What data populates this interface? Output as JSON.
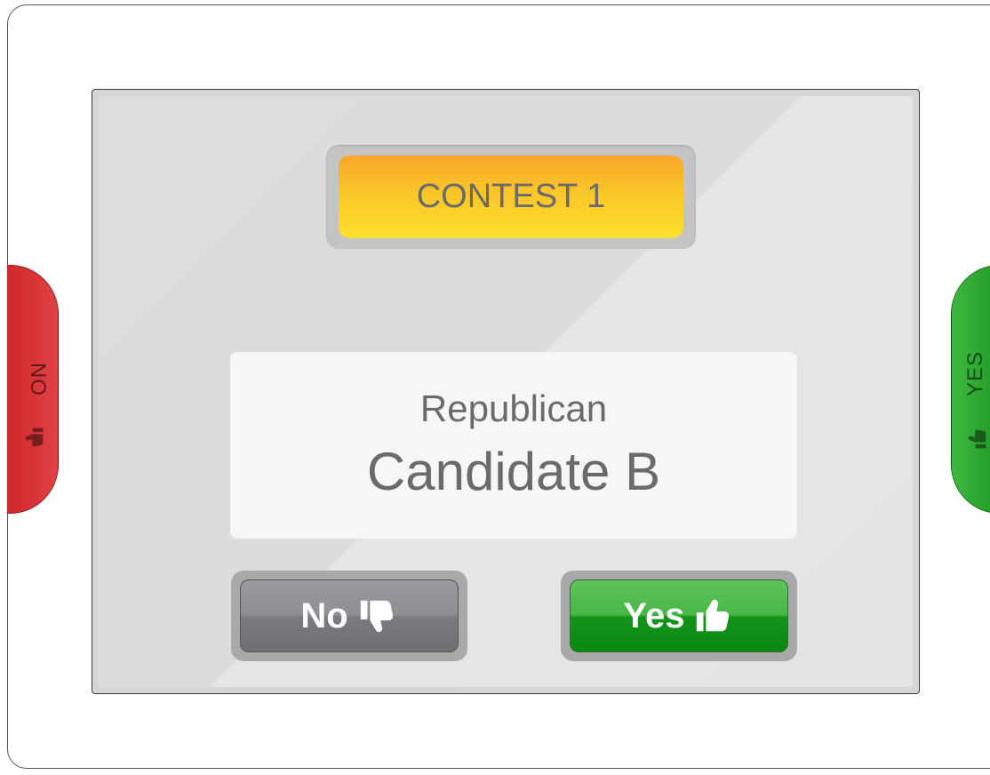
{
  "contest": {
    "title": "CONTEST 1"
  },
  "candidate": {
    "party": "Republican",
    "name": "Candidate B"
  },
  "buttons": {
    "no_label": "No",
    "yes_label": "Yes"
  },
  "side_tabs": {
    "no_label": "NO",
    "yes_label": "YES"
  },
  "icons": {
    "no": "thumbs-down-icon",
    "yes": "thumbs-up-icon"
  },
  "colors": {
    "no_side": "#d32b2e",
    "yes_side": "#1f9a25",
    "contest_pill": "#fbc629",
    "no_button": "#8f8f94",
    "yes_button": "#12931a"
  }
}
